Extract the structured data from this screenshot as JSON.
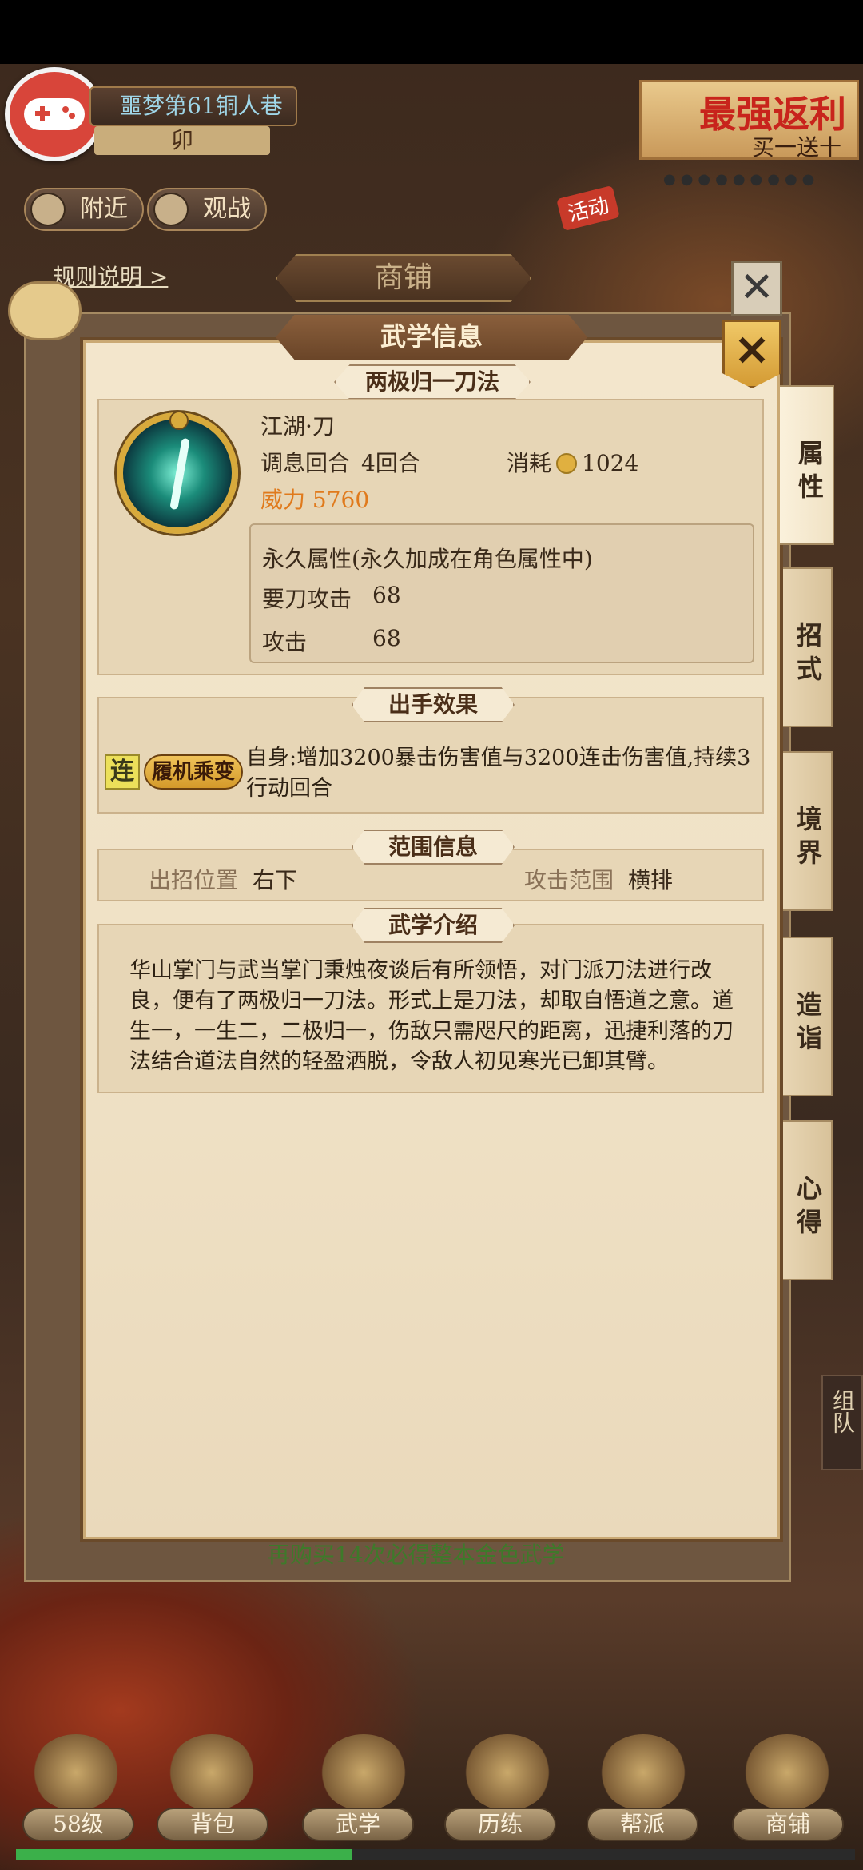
{
  "hud": {
    "location": "噩梦第61铜人巷",
    "location_sub": "卯",
    "nearby_btn": "附近",
    "watch_btn": "观战",
    "promo_title": "最强返利",
    "promo_sub": "买一送十",
    "activity_tag": "活动"
  },
  "shop": {
    "title": "商铺",
    "rules_link": "规则说明 >",
    "footer_text": "再购买14次必得整本金色武学"
  },
  "dialog": {
    "title": "武学信息",
    "skill_name": "两极归一刀法",
    "skill_type": "江湖·刀",
    "rest_rounds_label": "调息回合",
    "rest_rounds_value": "4回合",
    "cost_label": "消耗",
    "cost_value": "1024",
    "power": "威力 5760",
    "perm_title": "永久属性(永久加成在角色属性中)",
    "perm_attrs": [
      {
        "name": "要刀攻击",
        "value": "68"
      },
      {
        "name": "攻击",
        "value": "68"
      }
    ],
    "effect_section": "出手效果",
    "effect_badge_1": "连",
    "effect_badge_2": "履机乘变",
    "effect_text": "自身:增加3200暴击伤害值与3200连击伤害值,持续3行动回合",
    "range_section": "范围信息",
    "position_label": "出招位置",
    "position_value": "右下",
    "range_label": "攻击范围",
    "range_value": "横排",
    "intro_section": "武学介绍",
    "intro_text": "华山掌门与武当掌门秉烛夜谈后有所领悟，对门派刀法进行改良，便有了两极归一刀法。形式上是刀法，却取自悟道之意。道生一，一生二，二极归一，伤敌只需咫尺的距离，迅捷利落的刀法结合道法自然的轻盈洒脱，令敌人初见寒光已卸其臂。"
  },
  "side_tabs": [
    "属性",
    "招式",
    "境界",
    "造诣",
    "心得"
  ],
  "group_tab": "组队",
  "nav": [
    "58级",
    "背包",
    "武学",
    "历练",
    "帮派",
    "商铺"
  ],
  "progress": 0.4,
  "colors": {
    "accent_gold": "#d8aa3c",
    "power_orange": "#e07a1c",
    "parchment": "#f3e6cc",
    "footer_green": "#3e7a2a"
  }
}
